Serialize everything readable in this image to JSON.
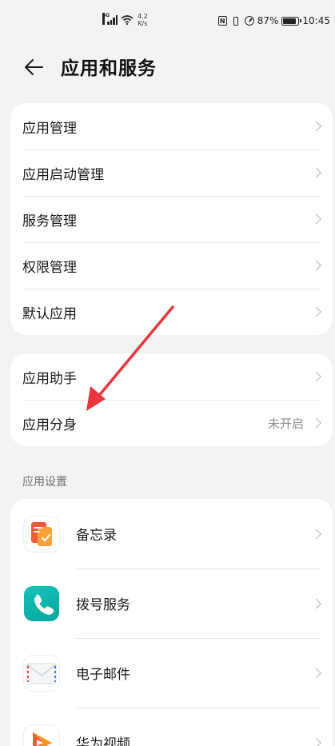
{
  "status_bar": {
    "signal_tag": "4G",
    "net_speed_value": "4.2",
    "net_speed_unit": "K/s",
    "nfc_letter": "N",
    "battery_percent": "87%",
    "time": "10:45",
    "battery_level": 0.87
  },
  "header": {
    "back_icon": "arrow-left-icon",
    "title": "应用和服务"
  },
  "group1": {
    "items": [
      {
        "label": "应用管理"
      },
      {
        "label": "应用启动管理"
      },
      {
        "label": "服务管理"
      },
      {
        "label": "权限管理"
      },
      {
        "label": "默认应用"
      }
    ]
  },
  "group2": {
    "items": [
      {
        "label": "应用助手"
      },
      {
        "label": "应用分身",
        "value": "未开启"
      }
    ]
  },
  "app_settings": {
    "section_label": "应用设置",
    "apps": [
      {
        "label": "备忘录",
        "icon": "memo-icon"
      },
      {
        "label": "拨号服务",
        "icon": "phone-icon"
      },
      {
        "label": "电子邮件",
        "icon": "mail-icon"
      },
      {
        "label": "华为视频",
        "icon": "video-icon"
      }
    ]
  },
  "colors": {
    "background": "#f1f3f5",
    "card": "#ffffff",
    "annotation_arrow": "#e8363d",
    "dialer_teal": "#10b8ae",
    "memo_orange": "#f5702e",
    "video_orange": "#f7931e"
  }
}
